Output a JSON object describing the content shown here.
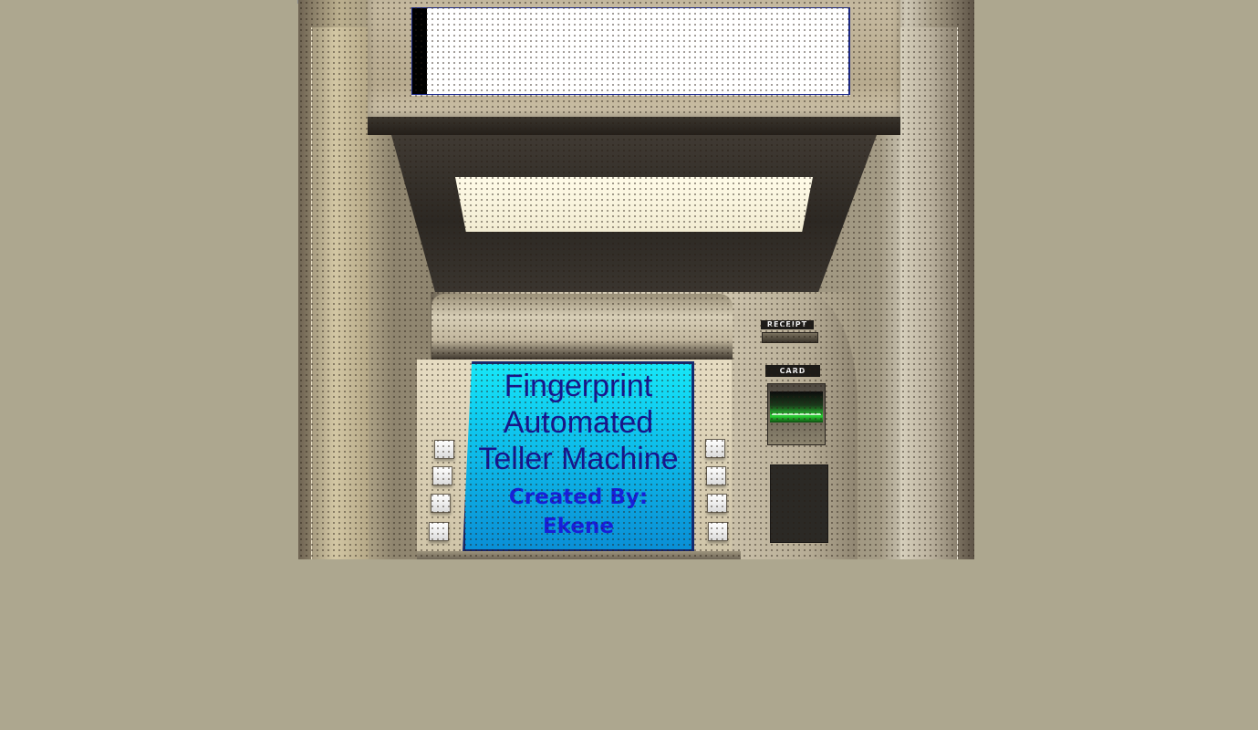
{
  "window": {
    "title": ""
  },
  "display": {
    "message": ""
  },
  "screen": {
    "title_lines": [
      "Fingerprint",
      "Automated",
      "Teller Machine"
    ],
    "credit_label": "Created By:",
    "credit_name": "Ekene"
  },
  "slots": {
    "receipt_label": "RECEIPT",
    "card_label": "CARD"
  },
  "colors": {
    "page_background": "#ada78f",
    "screen_text": "#18168e",
    "credit_text": "#1820d8",
    "screen_top": "#17e7f7",
    "screen_bottom": "#0a8fd6",
    "card_light": "#29d133"
  },
  "icons": {
    "receipt_slot": "receipt-slot-icon",
    "card_slot": "card-slot-icon",
    "cash_dispenser": "cash-dispenser-icon"
  }
}
